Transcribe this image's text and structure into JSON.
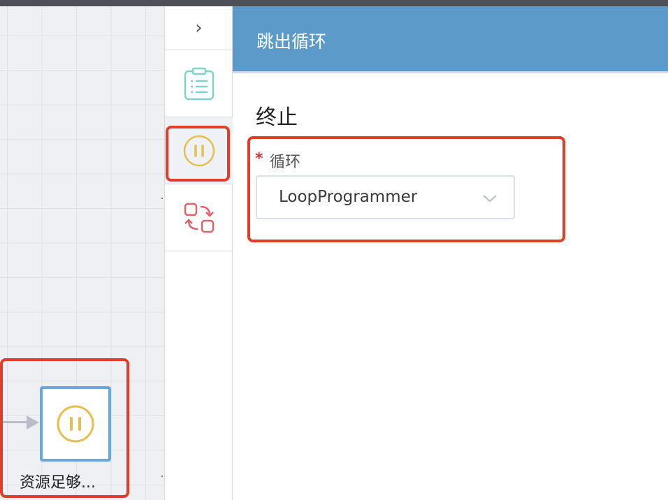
{
  "panel": {
    "title": "跳出循环",
    "section_title": "终止",
    "field": {
      "required_mark": "*",
      "label": "循环",
      "selected_value": "LoopProgrammer"
    }
  },
  "canvas": {
    "node": {
      "label": "资源足够..."
    }
  },
  "toolbar": {
    "collapse_glyph": "›",
    "items": [
      "collapse-icon",
      "clipboard-list-icon",
      "pause-icon",
      "swap-icon"
    ]
  },
  "colors": {
    "header": "#5b9ac9",
    "highlight": "#e23d28",
    "pause_icon": "#e6bf4a",
    "list_icon": "#7fd3c8",
    "swap_icon": "#e0626b",
    "node_border": "#65a8e2"
  }
}
